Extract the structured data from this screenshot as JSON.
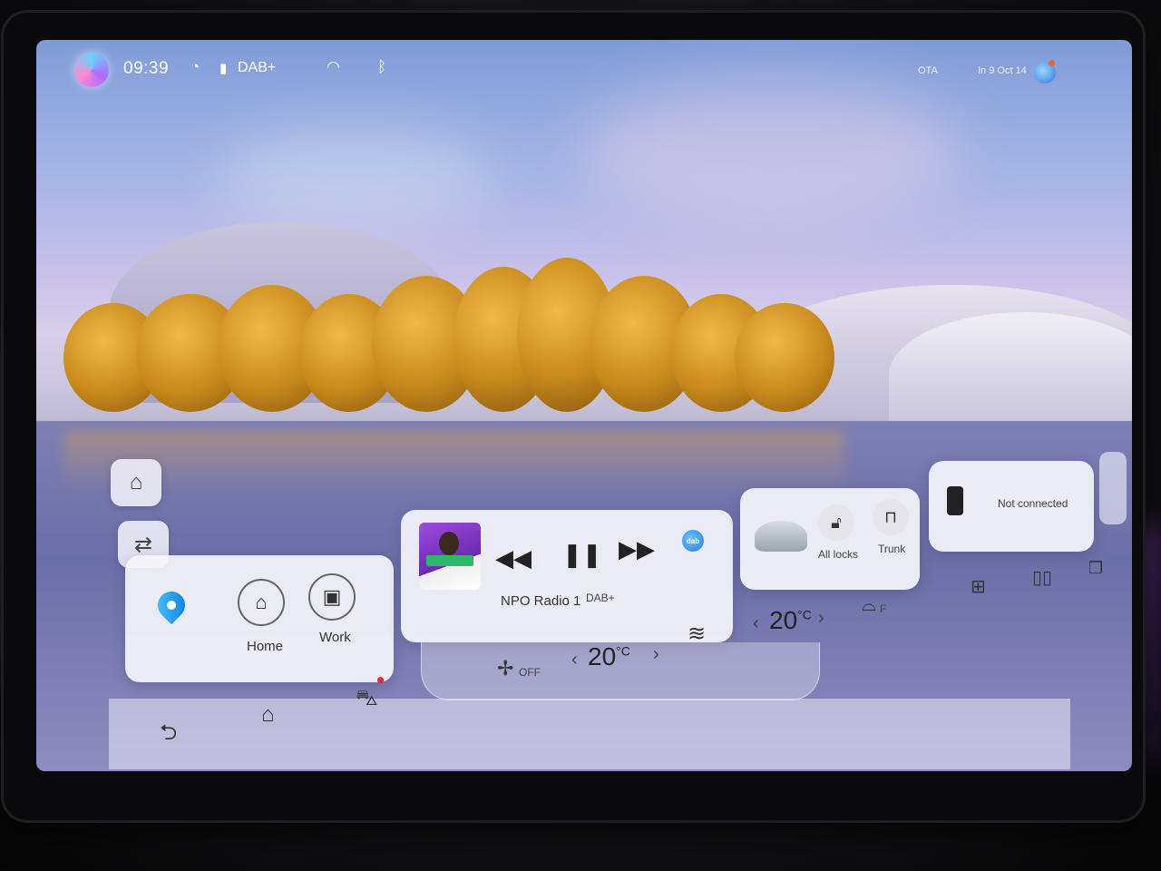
{
  "status_bar": {
    "time": "09:39",
    "radio_label": "DAB+",
    "ota_label": "OTA",
    "date_label": "In 9 Oct 14",
    "icons": [
      "assistant-avatar-icon",
      "speed-icon",
      "signal-icon",
      "wifi-icon",
      "bluetooth-icon",
      "globe-icon"
    ]
  },
  "side_buttons": [
    {
      "name": "wash-icon"
    },
    {
      "name": "home-switch-icon"
    }
  ],
  "navigation": {
    "home_label": "Home",
    "work_label": "Work"
  },
  "media": {
    "station": "NPO Radio 1",
    "source": "DAB+",
    "badge": "dab",
    "controls": [
      "rewind-icon",
      "pause-icon",
      "fast-forward-icon"
    ]
  },
  "vehicle": {
    "locks_label": "All locks",
    "trunk_label": "Trunk"
  },
  "phone": {
    "status": "Not connected"
  },
  "climate": {
    "fan_label": "OFF",
    "driver_temp": "20",
    "passenger_temp": "20",
    "unit": "°C",
    "defrost_label": "F"
  },
  "colors": {
    "accent": "#0a7ad8",
    "notification": "#e8283a",
    "foliage": "#e0a030"
  }
}
